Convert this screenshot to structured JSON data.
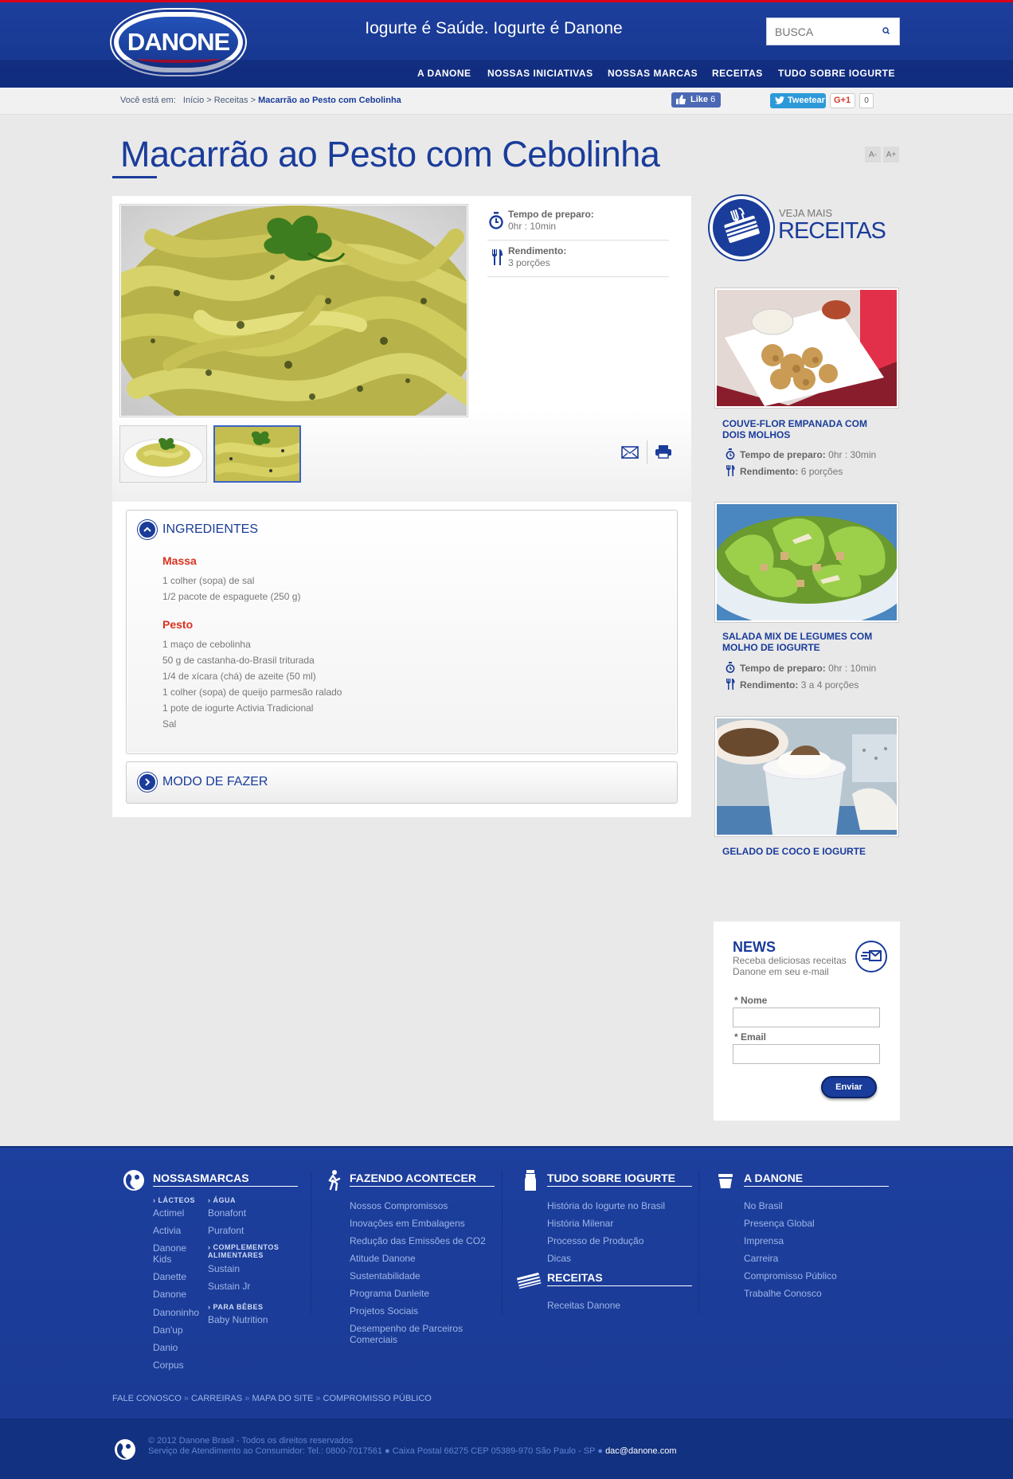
{
  "header": {
    "logo_text": "DANONE",
    "slogan": "Iogurte é Saúde. Iogurte é Danone",
    "search_placeholder": "BUSCA",
    "nav": [
      "A DANONE",
      "NOSSAS INICIATIVAS",
      "NOSSAS MARCAS",
      "RECEITAS",
      "TUDO SOBRE IOGURTE"
    ]
  },
  "breadcrumb": {
    "prefix": "Você está em:",
    "items": [
      "Início",
      "Receitas"
    ],
    "current": "Macarrão ao Pesto com Cebolinha"
  },
  "social": {
    "like": "Like",
    "like_count": "6",
    "tweet": "Tweetear",
    "gplus": "G+1",
    "gplus_count": "0"
  },
  "font_controls": [
    "A-",
    "A+"
  ],
  "recipe": {
    "title": "Macarrão ao Pesto com Cebolinha",
    "prep_label": "Tempo de preparo:",
    "prep_value": "0hr : 10min",
    "yield_label": "Rendimento:",
    "yield_value": "3 porções",
    "ingredients_title": "INGREDIENTES",
    "groups": [
      {
        "name": "Massa",
        "items": [
          "1 colher (sopa) de sal",
          "1/2 pacote de espaguete (250 g)"
        ]
      },
      {
        "name": "Pesto",
        "items": [
          "1 maço de cebolinha",
          "50 g de castanha-do-Brasil triturada",
          "1/4 de xícara (chá) de azeite (50 ml)",
          "1 colher (sopa) de queijo parmesão ralado",
          "1 pote de iogurte Activia Tradicional",
          "Sal"
        ]
      }
    ],
    "method_title": "MODO DE FAZER"
  },
  "sidebar": {
    "veja_small": "VEJA MAIS",
    "veja_big": "RECEITAS",
    "recipes": [
      {
        "title": "COUVE-FLOR EMPANADA COM DOIS MOLHOS",
        "prep_label": "Tempo de preparo:",
        "prep": "0hr : 30min",
        "yield_label": "Rendimento:",
        "yield": "6 porções"
      },
      {
        "title": "SALADA MIX DE LEGUMES COM MOLHO DE IOGURTE",
        "prep_label": "Tempo de preparo:",
        "prep": "0hr : 10min",
        "yield_label": "Rendimento:",
        "yield": "3 a 4 porções"
      },
      {
        "title": "GELADO DE COCO E IOGURTE"
      }
    ],
    "news": {
      "title": "NEWS",
      "subtitle": "Receba deliciosas receitas Danone em seu e-mail",
      "name_label": "* Nome",
      "email_label": "* Email",
      "submit": "Enviar"
    }
  },
  "footer": {
    "col1": {
      "title": "NOSSASMARCAS",
      "cat_lacteos": "LÁCTEOS",
      "lacteos": [
        "Actimel",
        "Activia",
        "Danone Kids",
        "Danette",
        "Danone",
        "Danoninho",
        "Dan'up",
        "Danio",
        "Corpus"
      ],
      "cat_agua": "ÁGUA",
      "agua": [
        "Bonafont",
        "Purafont"
      ],
      "cat_complementos": "COMPLEMENTOS ALIMENTARES",
      "complementos": [
        "Sustain",
        "Sustain Jr"
      ],
      "cat_bebes": "PARA BÊBES",
      "bebes": [
        "Baby Nutrition"
      ]
    },
    "col2": {
      "title": "FAZENDO ACONTECER",
      "links": [
        "Nossos Compromissos",
        "Inovações em Embalagens",
        "Redução das Emissões de CO2",
        "Atitude Danone",
        "Sustentabilidade",
        "Programa Danleite",
        "Projetos Sociais",
        "Desempenho de Parceiros Comerciais"
      ]
    },
    "col3": {
      "title": "TUDO SOBRE IOGURTE",
      "links": [
        "História do Iogurte no Brasil",
        "História Milenar",
        "Processo de Produção",
        "Dicas"
      ],
      "receitas_title": "RECEITAS",
      "receitas_links": [
        "Receitas Danone"
      ]
    },
    "col4": {
      "title": "A DANONE",
      "links": [
        "No Brasil",
        "Presença Global",
        "Imprensa",
        "Carreira",
        "Compromisso Público",
        "Trabalhe Conosco"
      ]
    },
    "bottom_links": [
      "FALE CONOSCO",
      "CARREIRAS",
      "MAPA DO SITE",
      "COMPROMISSO PÚBLICO"
    ],
    "copyright": "© 2012 Danone Brasil - Todos os direitos reservados",
    "sac_prefix": "Serviço de Atendimento ao Consumidor: Tel.: 0800-7017561 ● Caixa Postal 66275 CEP 05389-970 São Paulo - SP ●",
    "sac_email": "dac@danone.com"
  },
  "colors": {
    "brand_blue": "#1a3c9a",
    "accent_red": "#d8321e",
    "header_red_line": "#d9001b"
  }
}
